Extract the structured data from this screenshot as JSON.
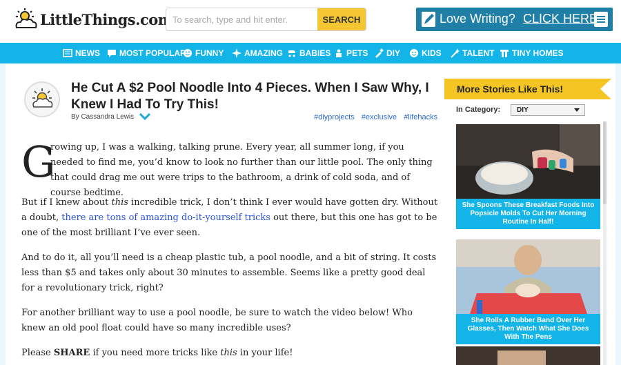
{
  "header": {
    "logo_text": "LittleThings.com",
    "search_placeholder": "To search, type and hit enter.",
    "search_button": "SEARCH",
    "promo_text": "Love Writing?",
    "promo_link": "CLICK HERE"
  },
  "nav": {
    "items": [
      {
        "label": "NEWS",
        "icon": "newspaper-icon"
      },
      {
        "label": "MOST POPULAR",
        "icon": "chat-icon"
      },
      {
        "label": "FUNNY",
        "icon": "smiley-icon"
      },
      {
        "label": "AMAZING",
        "icon": "burst-icon"
      },
      {
        "label": "BABIES",
        "icon": "stroller-icon"
      },
      {
        "label": "PETS",
        "icon": "pets-icon"
      },
      {
        "label": "DIY",
        "icon": "brush-icon"
      },
      {
        "label": "KIDS",
        "icon": "kids-icon"
      },
      {
        "label": "TALENT",
        "icon": "wand-icon"
      },
      {
        "label": "TINY HOMES",
        "icon": "house-icon"
      }
    ]
  },
  "article": {
    "title": "He Cut A $2 Pool Noodle Into 4 Pieces. When I Saw Why, I Knew I Had To Try This!",
    "byline": "By Cassandra Lewis",
    "tags": [
      "#diyprojects",
      "#exclusive",
      "#lifehacks"
    ],
    "dropcap": "G",
    "p1": "rowing up, I was a walking, talking prune. Every year, all summer long, if you needed to find me, you’d know to look no further than our little pool. The only thing that could drag me out were trips to the bathroom, a drink of cold soda, and of course bedtime.",
    "p2_a": "But if I knew about ",
    "p2_em": "this",
    "p2_b": " incredible trick, I don’t think I ever would have gotten dry. Without a doubt, ",
    "p2_link": "there are tons of amazing do-it-yourself tricks",
    "p2_c": " out there, but this one has got to be one of the most brilliant I’ve ever seen.",
    "p3": "And to do it, all you’ll need is a cheap plastic tub, a pool noodle, and a bit of string. It costs less than $5 and takes only about 30 minutes to assemble. Seems like a pretty good deal for a revolutionary trick, right?",
    "p4": "For another brilliant way to use a pool noodle, be sure to watch the video below! Who knew an old pool float could have so many incredible uses?",
    "p5_a": "Please ",
    "p5_strong": "SHARE",
    "p5_b": " if you need more tricks like ",
    "p5_em": "this",
    "p5_c": " in your life!"
  },
  "sidebar": {
    "heading": "More Stories Like This!",
    "category_label": "In Category:",
    "category_value": "DIY",
    "cards": [
      {
        "caption": "She Spoons These Breakfast Foods Into Popsicle Molds To Cut Her Morning Routine In Half!"
      },
      {
        "caption": "She Rolls A Rubber Band Over Her Glasses, Then Watch What She Does With The Pens"
      }
    ]
  },
  "colors": {
    "nav_blue": "#13b4e8",
    "promo_blue": "#1f7fa6",
    "search_yellow": "#f4c732",
    "banner_yellow": "#f5c623",
    "link_blue": "#2a52d4"
  }
}
